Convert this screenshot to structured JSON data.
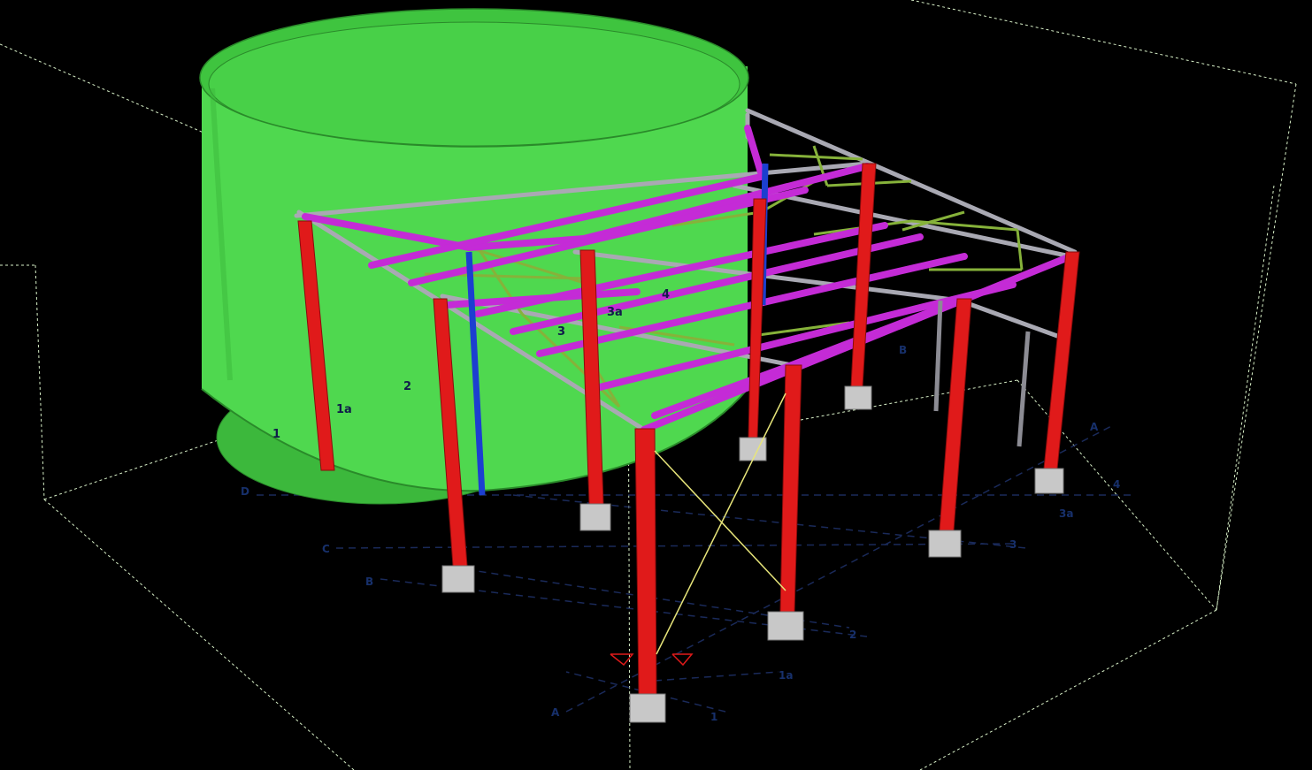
{
  "viewport": {
    "background": "#000000",
    "bounding_box_color": "#d8f0c8",
    "gridline_color": "#1a2a5a"
  },
  "colors": {
    "tank": "#4fd84f",
    "tank_dark": "#35a835",
    "columns": "#e01a1a",
    "rafters": "#c42bd6",
    "purlins": "#a9a9b3",
    "bracing": "#86b23a",
    "blue_column": "#1c3fd0",
    "cable_bracing": "#e7e57a",
    "base_plate": "#c8c8c8"
  },
  "grid_labels": {
    "letters_left": [
      "D",
      "C",
      "B",
      "A"
    ],
    "numbers_front": [
      "1",
      "1a",
      "2",
      "3",
      "3a",
      "4"
    ],
    "letters_right": [
      "B",
      "A"
    ]
  },
  "member_labels": {
    "tank_1": "1",
    "tank_1a": "1a",
    "tank_2": "2",
    "roof_3": "3",
    "roof_3a": "3a",
    "roof_4": "4"
  }
}
